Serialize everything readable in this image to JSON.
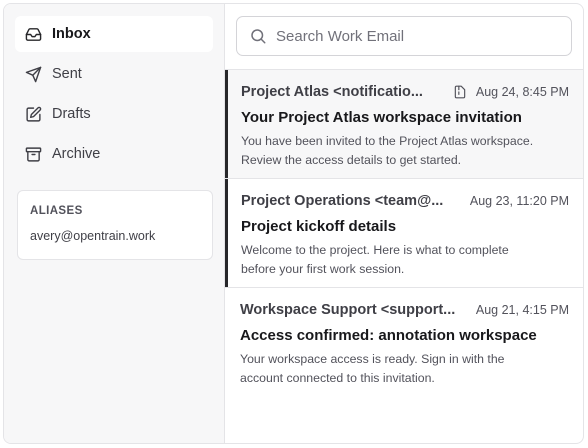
{
  "sidebar": {
    "items": [
      {
        "label": "Inbox",
        "icon": "inbox-icon",
        "active": true
      },
      {
        "label": "Sent",
        "icon": "send-icon",
        "active": false
      },
      {
        "label": "Drafts",
        "icon": "edit-icon",
        "active": false
      },
      {
        "label": "Archive",
        "icon": "archive-icon",
        "active": false
      }
    ],
    "aliases": {
      "title": "ALIASES",
      "email": "avery@opentrain.work"
    }
  },
  "search": {
    "placeholder": "Search Work Email",
    "value": ""
  },
  "emails": [
    {
      "sender": "Project Atlas <notificatio...",
      "has_attachment": true,
      "date": "Aug 24, 8:45 PM",
      "subject": "Your Project Atlas workspace invitation",
      "preview": "You have been invited to the Project Atlas workspace. Review the access details to get started."
    },
    {
      "sender": "Project Operations <team@...",
      "has_attachment": false,
      "date": "Aug 23, 11:20 PM",
      "subject": "Project kickoff details",
      "preview": "Welcome to the project. Here is what to complete before your first work session."
    },
    {
      "sender": "Workspace Support <support...",
      "has_attachment": false,
      "date": "Aug 21, 4:15 PM",
      "subject": "Access confirmed: annotation workspace",
      "preview": "Your workspace access is ready. Sign in with the account connected to this invitation."
    }
  ],
  "colors": {
    "accent": "#27272a",
    "sidebar_bg": "#f7f7f8",
    "border": "#e4e4e7"
  }
}
